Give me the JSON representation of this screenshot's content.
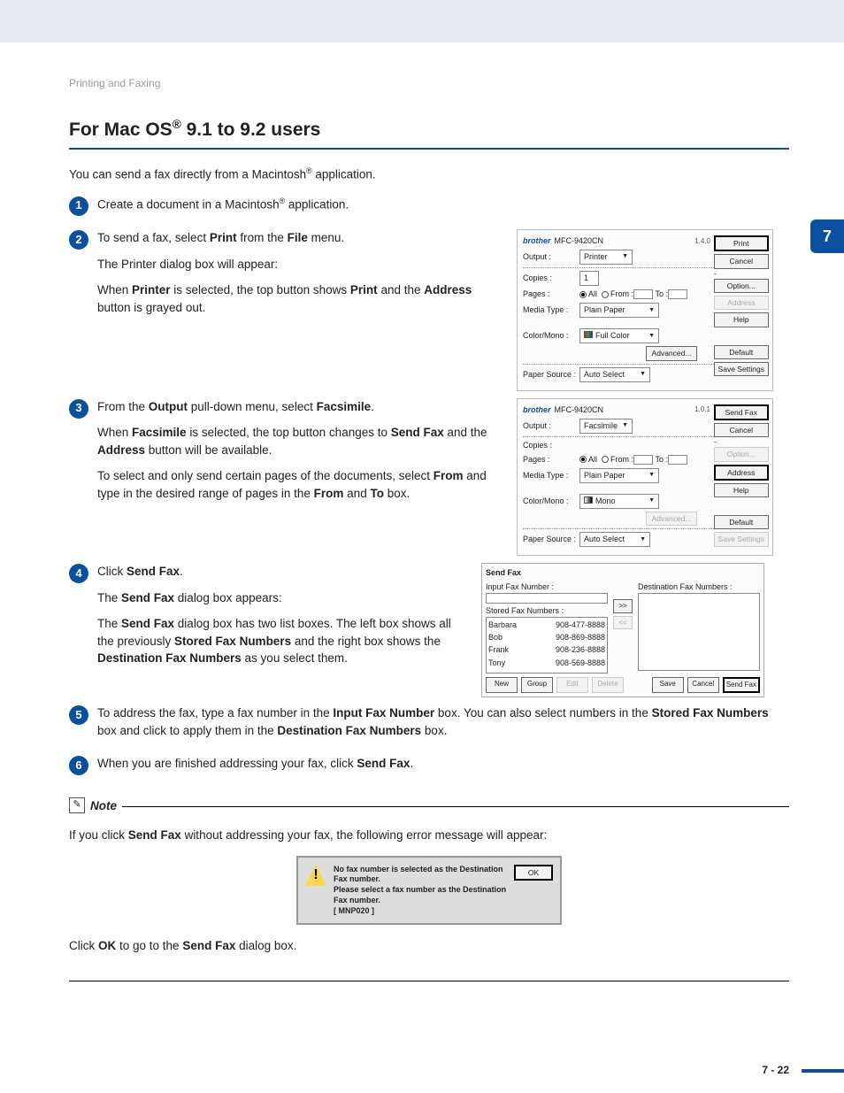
{
  "breadcrumb": "Printing and Faxing",
  "chapter_tab": "7",
  "section_title_pre": "For Mac OS",
  "section_title_reg": "®",
  "section_title_post": " 9.1 to 9.2 users",
  "intro_pre": "You can send a fax directly from a Macintosh",
  "intro_reg": "®",
  "intro_post": " application.",
  "step1": {
    "num": "1",
    "pre": "Create a document in a Macintosh",
    "reg": "®",
    "post": " application."
  },
  "step2": {
    "num": "2",
    "line1_a": "To send a fax, select ",
    "line1_b": "Print",
    "line1_c": " from the ",
    "line1_d": "File",
    "line1_e": " menu.",
    "line2": "The Printer dialog box will appear:",
    "line3_a": "When ",
    "line3_b": "Printer",
    "line3_c": " is selected, the top button shows ",
    "line3_d": "Print",
    "line3_e": " and the ",
    "line3_f": "Address",
    "line3_g": " button is grayed out."
  },
  "step3": {
    "num": "3",
    "line1_a": "From the ",
    "line1_b": "Output",
    "line1_c": " pull-down menu, select ",
    "line1_d": "Facsimile",
    "line1_e": ".",
    "line2_a": "When ",
    "line2_b": "Facsimile",
    "line2_c": " is selected, the top button changes to ",
    "line2_d": "Send Fax",
    "line2_e": " and the ",
    "line2_f": "Address",
    "line2_g": " button will be available.",
    "line3_a": "To select and only send certain pages of the documents, select ",
    "line3_b": "From",
    "line3_c": " and type in the desired range of pages in the ",
    "line3_d": "From",
    "line3_e": " and ",
    "line3_f": "To",
    "line3_g": " box."
  },
  "step4": {
    "num": "4",
    "line1_a": "Click ",
    "line1_b": "Send Fax",
    "line1_c": ".",
    "line2_a": "The ",
    "line2_b": "Send Fax",
    "line2_c": " dialog box appears:",
    "line3_a": "The ",
    "line3_b": "Send Fax",
    "line3_c": " dialog box has two list boxes. The left box shows all the previously ",
    "line3_d": "Stored Fax Numbers",
    "line3_e": " and the right box shows the ",
    "line3_f": "Destination Fax Numbers",
    "line3_g": " as you select them."
  },
  "step5": {
    "num": "5",
    "a": "To address the fax, type a fax number in the ",
    "b": "Input Fax Number",
    "c": " box. You can also select numbers in the ",
    "d": "Stored Fax Numbers",
    "e": " box and click to apply them in the ",
    "f": "Destination Fax Numbers",
    "g": " box."
  },
  "step6": {
    "num": "6",
    "a": "When you are finished addressing your fax, click ",
    "b": "Send Fax",
    "c": "."
  },
  "note": {
    "title": "Note",
    "body_a": "If you click ",
    "body_b": "Send Fax",
    "body_c": " without addressing your fax, the following error message will appear:",
    "after_a": "Click ",
    "after_b": "OK",
    "after_c": " to go to the ",
    "after_d": "Send Fax",
    "after_e": " dialog box."
  },
  "shot_common": {
    "brand": "brother",
    "model": "MFC-9420CN",
    "output": "Output :",
    "copies": "Copies :",
    "pages": "Pages :",
    "all": "All",
    "from": "From :",
    "to": "To :",
    "media": "Media Type :",
    "media_v": "Plain Paper",
    "color": "Color/Mono :",
    "advanced": "Advanced...",
    "source": "Paper Source :",
    "source_v": "Auto Select",
    "copies_v": "1"
  },
  "shot1": {
    "version": "1.4.0",
    "output_v": "Printer",
    "color_v": "Full Color",
    "btn_top": "Print",
    "btn_cancel": "Cancel",
    "btn_option": "Option...",
    "btn_addr": "Address",
    "btn_help": "Help",
    "btn_default": "Default",
    "btn_save": "Save Settings"
  },
  "shot2": {
    "version": "1.0.1",
    "output_v": "Facsimile",
    "color_v": "Mono",
    "btn_top": "Send Fax",
    "btn_cancel": "Cancel",
    "btn_option": "Option...",
    "btn_addr": "Address",
    "btn_help": "Help",
    "btn_default": "Default",
    "btn_save": "Save Settings"
  },
  "sendfax": {
    "title": "Send Fax",
    "input_label": "Input Fax Number :",
    "dest_label": "Destination Fax Numbers :",
    "stored_label": "Stored Fax Numbers :",
    "items": [
      {
        "name": "Barbara",
        "num": "908-477-8888"
      },
      {
        "name": "Bob",
        "num": "908-869-8888"
      },
      {
        "name": "Frank",
        "num": "908-236-8888"
      },
      {
        "name": "Tony",
        "num": "908-569-8888"
      }
    ],
    "arrow_r": ">>",
    "arrow_l": "<<",
    "btns": {
      "new": "New",
      "group": "Group",
      "edit": "Edit",
      "delete": "Delete",
      "save": "Save",
      "cancel": "Cancel",
      "send": "Send Fax"
    }
  },
  "alert": {
    "l1": "No fax number is selected as the Destination Fax number.",
    "l2": "Please select a fax number as the Destination Fax number.",
    "l3": "[ MNP020 ]",
    "ok": "OK"
  },
  "page_num": "7 - 22"
}
